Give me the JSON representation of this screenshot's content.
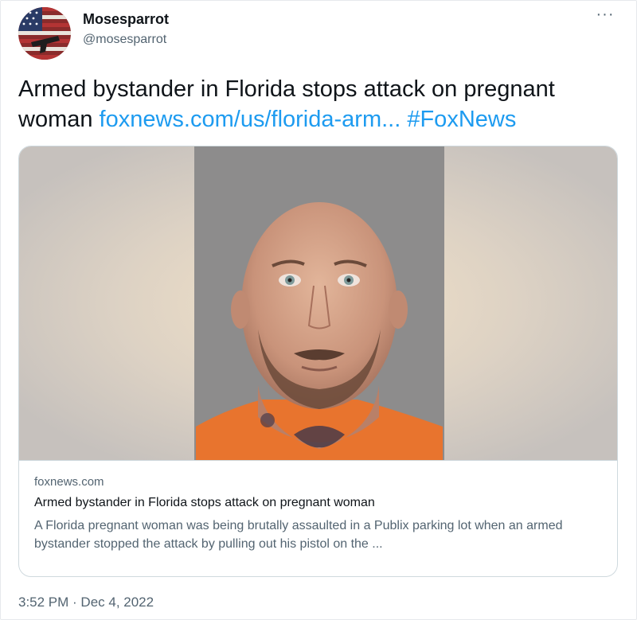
{
  "tweet": {
    "author_name": "Mosesparrot",
    "author_handle": "@mosesparrot",
    "more_label": "···",
    "text_plain": "Armed bystander in Florida stops attack on pregnant woman ",
    "link_text": "foxnews.com/us/florida-arm...",
    "hashtag": "#FoxNews",
    "timestamp": "3:52 PM · Dec 4, 2022"
  },
  "card": {
    "domain": "foxnews.com",
    "title": "Armed bystander in Florida stops attack on pregnant woman",
    "description": "A Florida pregnant woman was being brutally assaulted in a Publix parking lot when an armed bystander stopped the attack by pulling out his pistol on the ..."
  },
  "colors": {
    "link": "#1d9bf0",
    "text_primary": "#0f1419",
    "text_secondary": "#536471",
    "border": "#cfd9de"
  },
  "icons": {
    "more": "more-dots-icon",
    "avatar": "flag-gun-avatar"
  }
}
